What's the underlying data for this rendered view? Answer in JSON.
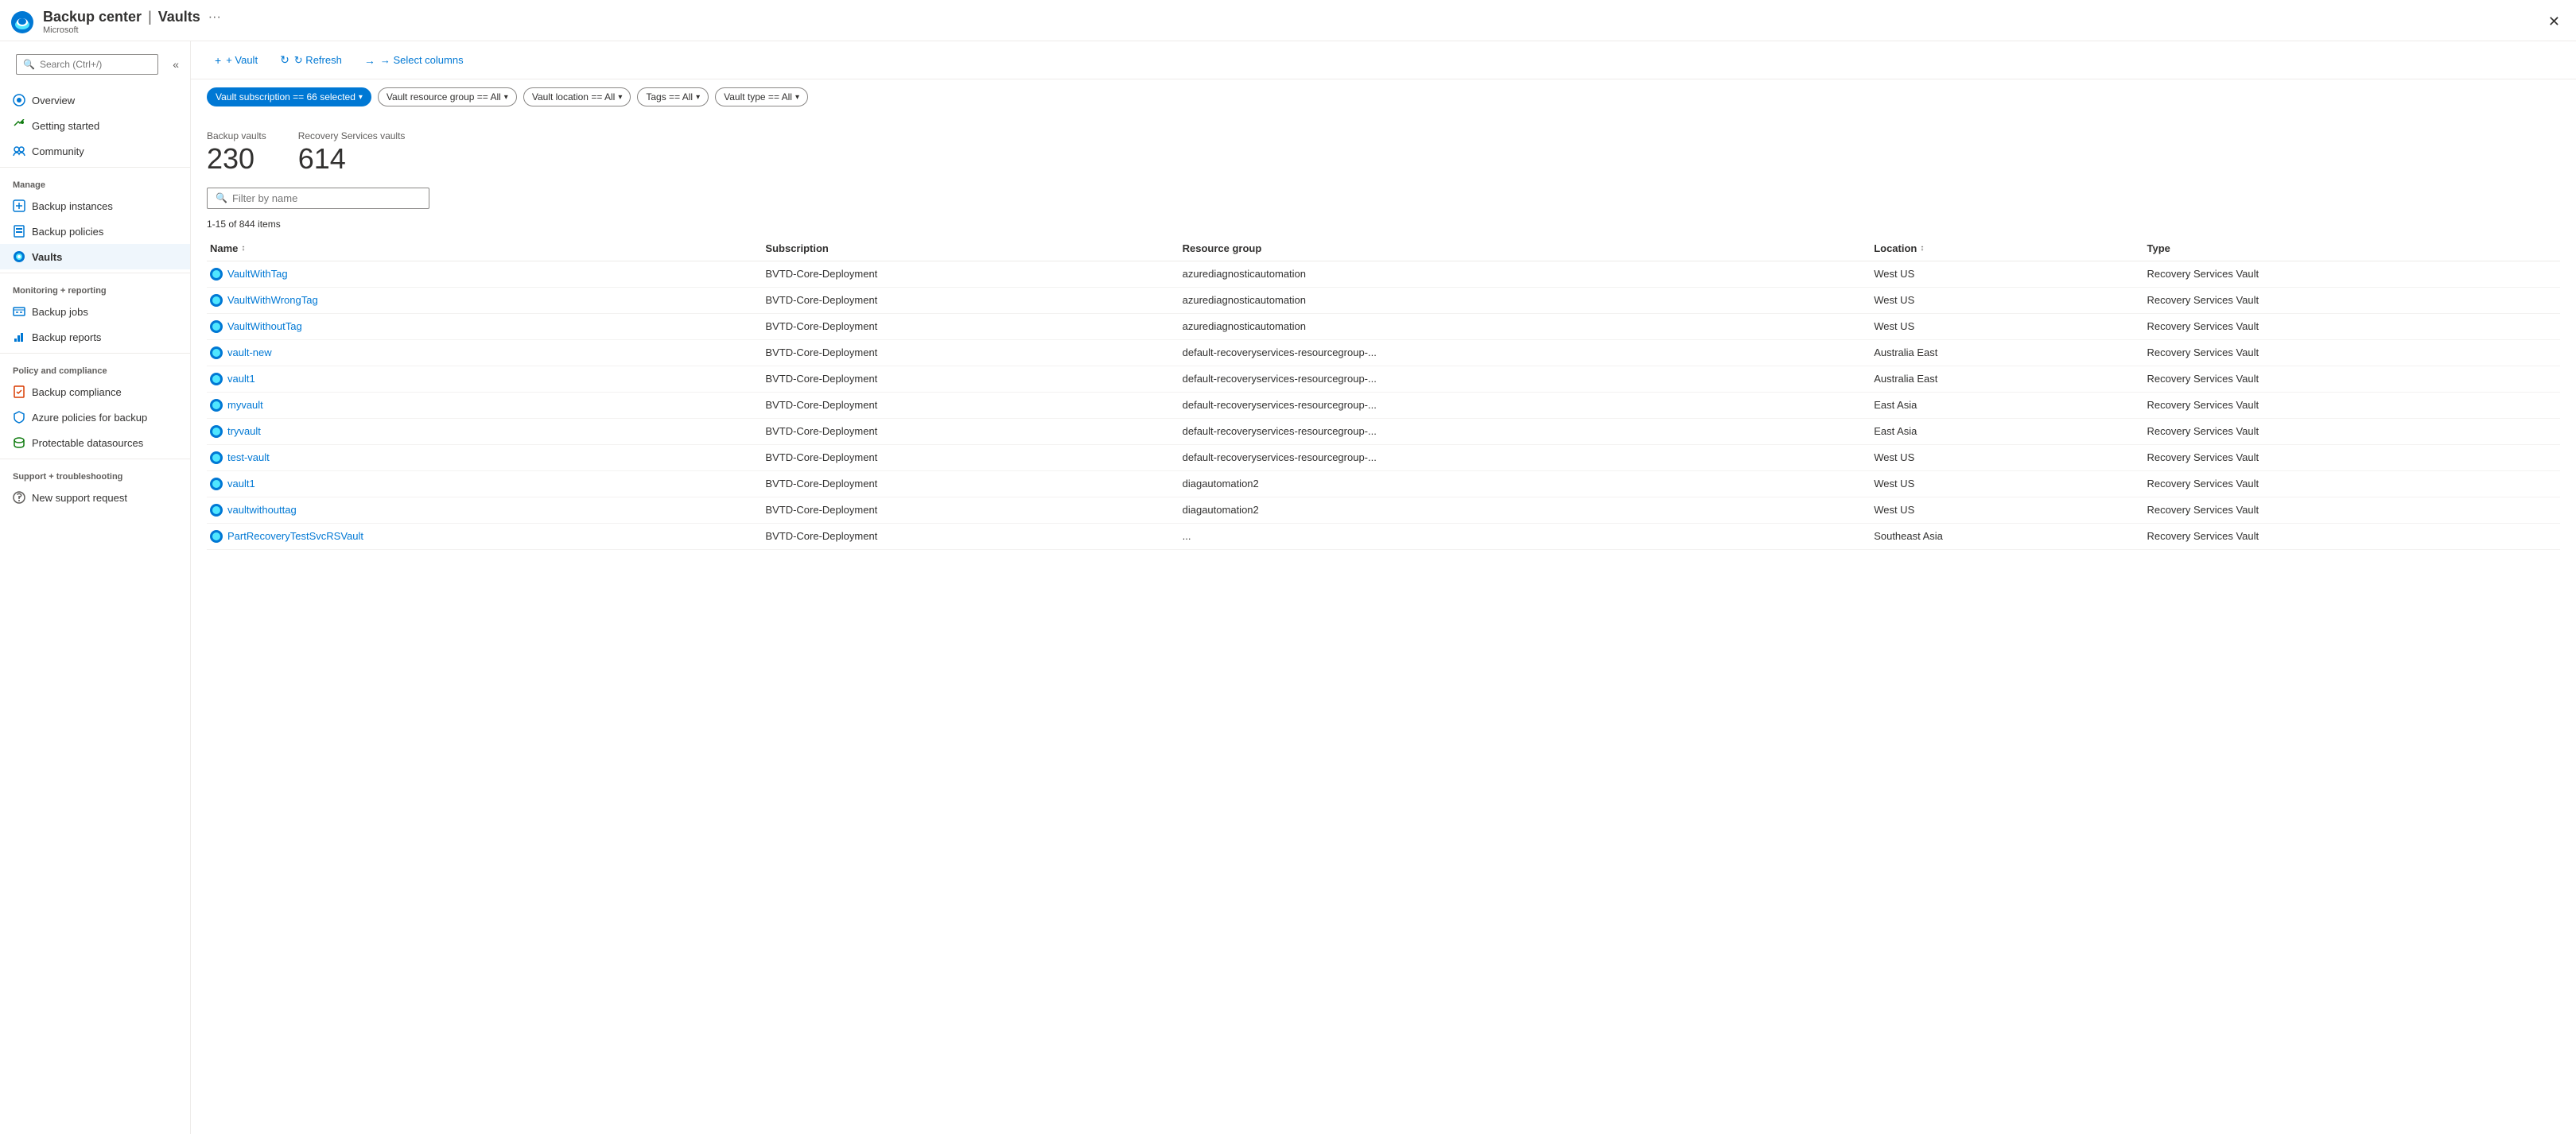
{
  "header": {
    "app_name": "Backup center",
    "separator": "|",
    "page_name": "Vaults",
    "subtitle": "Microsoft",
    "more_options_label": "···",
    "close_label": "✕"
  },
  "sidebar": {
    "search_placeholder": "Search (Ctrl+/)",
    "collapse_label": "«",
    "nav_items": [
      {
        "id": "overview",
        "label": "Overview",
        "icon": "overview-icon"
      },
      {
        "id": "getting-started",
        "label": "Getting started",
        "icon": "getting-started-icon"
      },
      {
        "id": "community",
        "label": "Community",
        "icon": "community-icon"
      }
    ],
    "sections": [
      {
        "label": "Manage",
        "items": [
          {
            "id": "backup-instances",
            "label": "Backup instances",
            "icon": "backup-instances-icon"
          },
          {
            "id": "backup-policies",
            "label": "Backup policies",
            "icon": "backup-policies-icon"
          },
          {
            "id": "vaults",
            "label": "Vaults",
            "icon": "vaults-icon",
            "active": true
          }
        ]
      },
      {
        "label": "Monitoring + reporting",
        "items": [
          {
            "id": "backup-jobs",
            "label": "Backup jobs",
            "icon": "backup-jobs-icon"
          },
          {
            "id": "backup-reports",
            "label": "Backup reports",
            "icon": "backup-reports-icon"
          }
        ]
      },
      {
        "label": "Policy and compliance",
        "items": [
          {
            "id": "backup-compliance",
            "label": "Backup compliance",
            "icon": "backup-compliance-icon"
          },
          {
            "id": "azure-policies",
            "label": "Azure policies for backup",
            "icon": "azure-policies-icon"
          },
          {
            "id": "protectable-datasources",
            "label": "Protectable datasources",
            "icon": "protectable-datasources-icon"
          }
        ]
      },
      {
        "label": "Support + troubleshooting",
        "items": [
          {
            "id": "new-support-request",
            "label": "New support request",
            "icon": "support-icon"
          }
        ]
      }
    ]
  },
  "toolbar": {
    "vault_label": "+ Vault",
    "refresh_label": "↻ Refresh",
    "select_columns_label": "→ Select columns"
  },
  "filters": {
    "subscription": "Vault subscription == 66 selected",
    "resource_group": "Vault resource group == All",
    "location": "Vault location == All",
    "tags": "Tags == All",
    "vault_type": "Vault type == All"
  },
  "stats": {
    "backup_vaults_label": "Backup vaults",
    "backup_vaults_value": "230",
    "recovery_vaults_label": "Recovery Services vaults",
    "recovery_vaults_value": "614"
  },
  "filter_input": {
    "placeholder": "Filter by name"
  },
  "items_count": "1-15 of 844 items",
  "table": {
    "columns": [
      "Name",
      "Subscription",
      "Resource group",
      "Location",
      "Type"
    ],
    "rows": [
      {
        "name": "VaultWithTag",
        "subscription": "BVTD-Core-Deployment",
        "resource_group": "azurediagnosticautomation",
        "location": "West US",
        "type": "Recovery Services Vault"
      },
      {
        "name": "VaultWithWrongTag",
        "subscription": "BVTD-Core-Deployment",
        "resource_group": "azurediagnosticautomation",
        "location": "West US",
        "type": "Recovery Services Vault"
      },
      {
        "name": "VaultWithoutTag",
        "subscription": "BVTD-Core-Deployment",
        "resource_group": "azurediagnosticautomation",
        "location": "West US",
        "type": "Recovery Services Vault"
      },
      {
        "name": "vault-new",
        "subscription": "BVTD-Core-Deployment",
        "resource_group": "default-recoveryservices-resourcegroup-...",
        "location": "Australia East",
        "type": "Recovery Services Vault"
      },
      {
        "name": "vault1",
        "subscription": "BVTD-Core-Deployment",
        "resource_group": "default-recoveryservices-resourcegroup-...",
        "location": "Australia East",
        "type": "Recovery Services Vault"
      },
      {
        "name": "myvault",
        "subscription": "BVTD-Core-Deployment",
        "resource_group": "default-recoveryservices-resourcegroup-...",
        "location": "East Asia",
        "type": "Recovery Services Vault"
      },
      {
        "name": "tryvault",
        "subscription": "BVTD-Core-Deployment",
        "resource_group": "default-recoveryservices-resourcegroup-...",
        "location": "East Asia",
        "type": "Recovery Services Vault"
      },
      {
        "name": "test-vault",
        "subscription": "BVTD-Core-Deployment",
        "resource_group": "default-recoveryservices-resourcegroup-...",
        "location": "West US",
        "type": "Recovery Services Vault"
      },
      {
        "name": "vault1",
        "subscription": "BVTD-Core-Deployment",
        "resource_group": "diagautomation2",
        "location": "West US",
        "type": "Recovery Services Vault"
      },
      {
        "name": "vaultwithouttag",
        "subscription": "BVTD-Core-Deployment",
        "resource_group": "diagautomation2",
        "location": "West US",
        "type": "Recovery Services Vault"
      },
      {
        "name": "PartRecoveryTestSvcRSVault",
        "subscription": "BVTD-Core-Deployment",
        "resource_group": "...",
        "location": "Southeast Asia",
        "type": "Recovery Services Vault"
      }
    ]
  }
}
